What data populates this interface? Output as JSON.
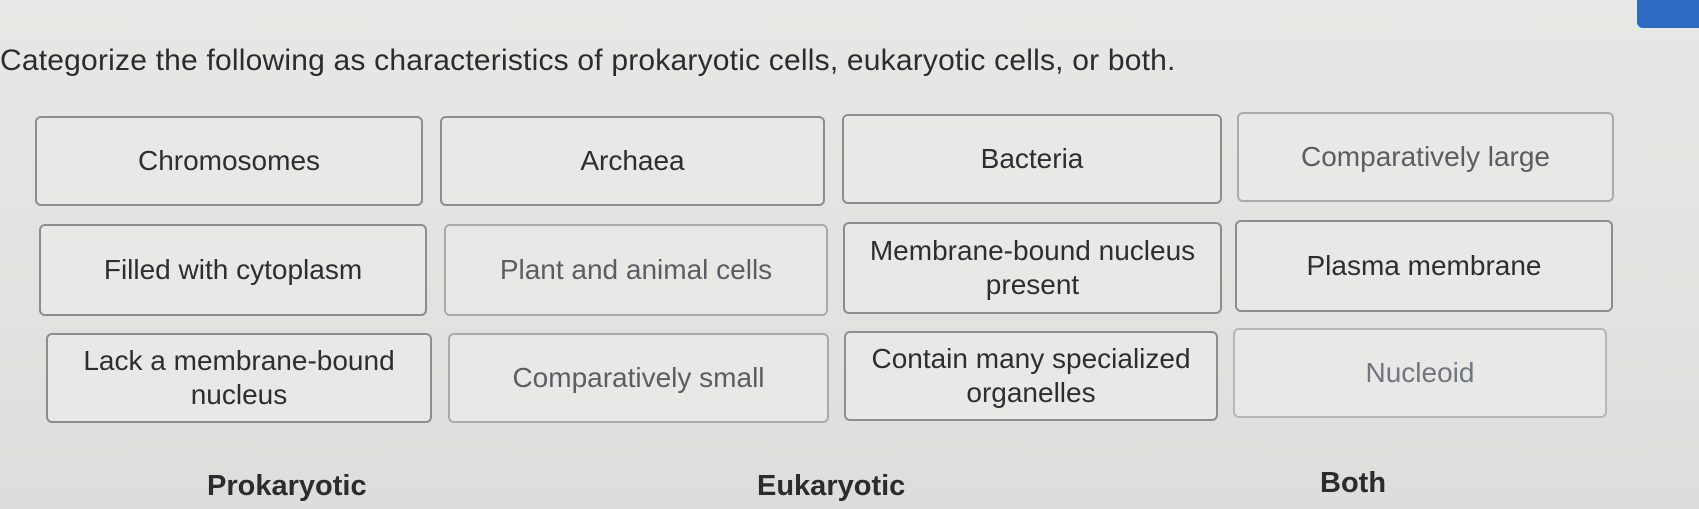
{
  "prompt": "Categorize the following as characteristics of prokaryotic cells, eukaryotic cells, or both.",
  "cards": [
    "Chromosomes",
    "Archaea",
    "Bacteria",
    "Comparatively large",
    "Filled with cytoplasm",
    "Plant and animal cells",
    "Membrane-bound nucleus present",
    "Plasma membrane",
    "Lack a membrane-bound nucleus",
    "Comparatively small",
    "Contain many specialized organelles",
    "Nucleoid"
  ],
  "categories": {
    "prokaryotic": "Prokaryotic",
    "eukaryotic": "Eukaryotic",
    "both": "Both"
  }
}
